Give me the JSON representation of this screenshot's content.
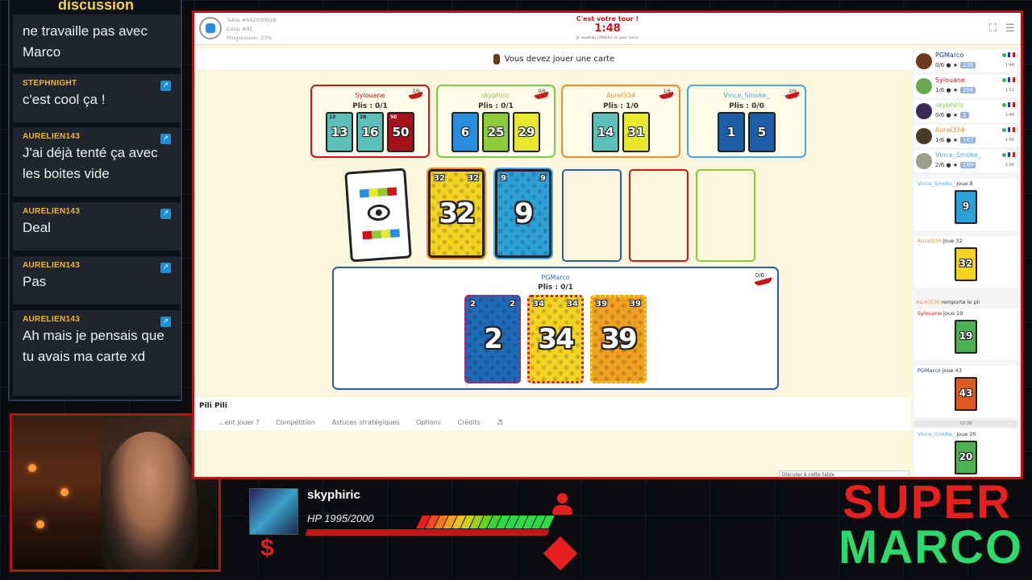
{
  "chat": {
    "title": "discussion",
    "messages": [
      {
        "user": "",
        "text": "ne travaille pas avec Marco"
      },
      {
        "user": "STEPHNIGHT",
        "text": "c'est cool ça !"
      },
      {
        "user": "AURELIEN143",
        "text": "J'ai déjà tenté ça avec les boites vide"
      },
      {
        "user": "AURELIEN143",
        "text": "Deal"
      },
      {
        "user": "AURELIEN143",
        "text": "Pas"
      },
      {
        "user": "AURELIEN143",
        "text": "Ah mais je pensais que tu avais ma carte xd"
      }
    ]
  },
  "game": {
    "table": "Table #692030928",
    "coup": "Coup #91",
    "progression": "Progression: 33%",
    "turn_label": "C'est votre tour !",
    "timer": "1:48",
    "turn_sub": "Je voudrais réfléchir un peu, merci",
    "instruction": "Vous devez jouer une carte",
    "players": [
      {
        "name": "Sylouane",
        "plis": "Plis : 0/1",
        "score": "1/6",
        "color": "#c8161d",
        "cards": [
          {
            "n": "13",
            "color": "#5cc0b8"
          },
          {
            "n": "16",
            "color": "#5cc0b8"
          },
          {
            "n": "50",
            "color": "#a5101a"
          }
        ]
      },
      {
        "name": "skyphiric",
        "plis": "Plis : 0/1",
        "score": "0/6",
        "color": "#7ec84a",
        "cards": [
          {
            "n": "6",
            "color": "#2a8ee0"
          },
          {
            "n": "25",
            "color": "#8ccc3a"
          },
          {
            "n": "29",
            "color": "#e8e830"
          }
        ]
      },
      {
        "name": "Aurel334",
        "plis": "Plis : 1/0",
        "score": "1/6",
        "color": "#f08a24",
        "cards": [
          {
            "n": "14",
            "color": "#5cc0b8"
          },
          {
            "n": "31",
            "color": "#e8e830"
          }
        ]
      },
      {
        "name": "Vince_Smoke_",
        "plis": "Plis : 0/0",
        "score": "2/6",
        "color": "#4aa8e0",
        "cards": [
          {
            "n": "1",
            "color": "#1e5ea8"
          },
          {
            "n": "5",
            "color": "#1e5ea8"
          }
        ]
      }
    ],
    "played": [
      {
        "n": "32",
        "color": "#f4d222"
      },
      {
        "n": "9",
        "color": "#2ea0d8"
      }
    ],
    "me": {
      "name": "PGMarco",
      "plis": "Plis : 0/1",
      "score": "0/6",
      "cards": [
        {
          "n": "2",
          "color": "#1e6ab8"
        },
        {
          "n": "34",
          "color": "#f4d222"
        },
        {
          "n": "39",
          "color": "#f0a020"
        }
      ]
    },
    "footer_title": "Pili Pili",
    "footer_tabs": [
      "...ent jouer ?",
      "Compétition",
      "Astuces stratégiques",
      "Options",
      "Crédits",
      "♬"
    ],
    "chat_input": "Discuter à cette table",
    "roster": [
      {
        "name": "PGMarco",
        "meta": "0/6 ● ★",
        "badge": "239",
        "time": "1:48",
        "color": "#1e3a8a"
      },
      {
        "name": "Sylouane",
        "meta": "1/6 ● ★",
        "badge": "256",
        "time": "1:51",
        "color": "#c8161d"
      },
      {
        "name": "skyphiric",
        "meta": "0/6 ● ★",
        "badge": "1",
        "time": "1:48",
        "color": "#7ec84a"
      },
      {
        "name": "Aurel334",
        "meta": "1/6 ● ★",
        "badge": "167",
        "time": "1:50",
        "color": "#f08a24"
      },
      {
        "name": "Vince_Smoke_",
        "meta": "2/6 ● ★",
        "badge": "169",
        "time": "2:00",
        "color": "#4aa8e0"
      }
    ],
    "log": [
      {
        "who": "Vince_Smoke_",
        "what": " joue 9",
        "color": "#4aa8e0",
        "card": {
          "n": "9",
          "color": "#2ea0d8"
        }
      },
      {
        "who": "Aurel334",
        "what": " joue 32",
        "color": "#f08a24",
        "card": {
          "n": "32",
          "color": "#f4d222"
        }
      },
      {
        "who": "Aurel334",
        "what": " remporte le pli",
        "color": "#f08a24"
      },
      {
        "who": "Sylouane",
        "what": " joue 19",
        "color": "#c8161d",
        "card": {
          "n": "19",
          "color": "#4cb050"
        }
      },
      {
        "who": "PGMarco",
        "what": " joue 43",
        "color": "#1e3a8a",
        "card": {
          "n": "43",
          "color": "#e05a20"
        }
      },
      {
        "time": "02:28"
      },
      {
        "who": "Vince_Smoke_",
        "what": " joue 20",
        "color": "#4aa8e0",
        "card": {
          "n": "20",
          "color": "#4cb050"
        }
      }
    ]
  },
  "hud": {
    "name": "skyphiric",
    "hp": "HP 1995/2000",
    "currency_icon": "$"
  },
  "brand": {
    "line1": "SUPER",
    "line2": "MARCO"
  }
}
